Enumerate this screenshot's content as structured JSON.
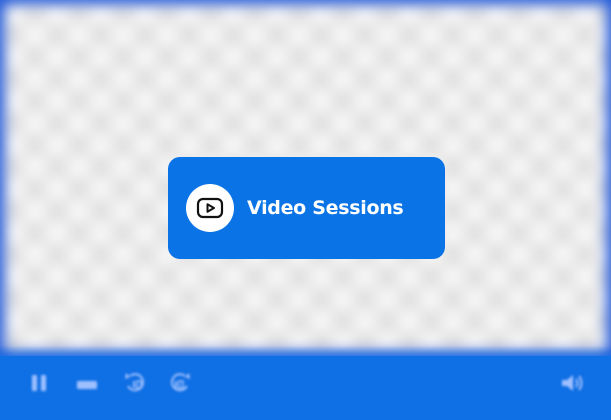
{
  "player": {
    "title": "Video Sessions",
    "accent_color": "#0a74e6",
    "bar_color": "#0f6fe4"
  },
  "controls": [
    {
      "name": "pause",
      "icon": "pause-icon"
    },
    {
      "name": "stop",
      "icon": "stop-icon"
    },
    {
      "name": "rewind",
      "icon": "replay-10-icon"
    },
    {
      "name": "forward",
      "icon": "forward-10-icon"
    },
    {
      "name": "volume",
      "icon": "volume-icon"
    }
  ]
}
